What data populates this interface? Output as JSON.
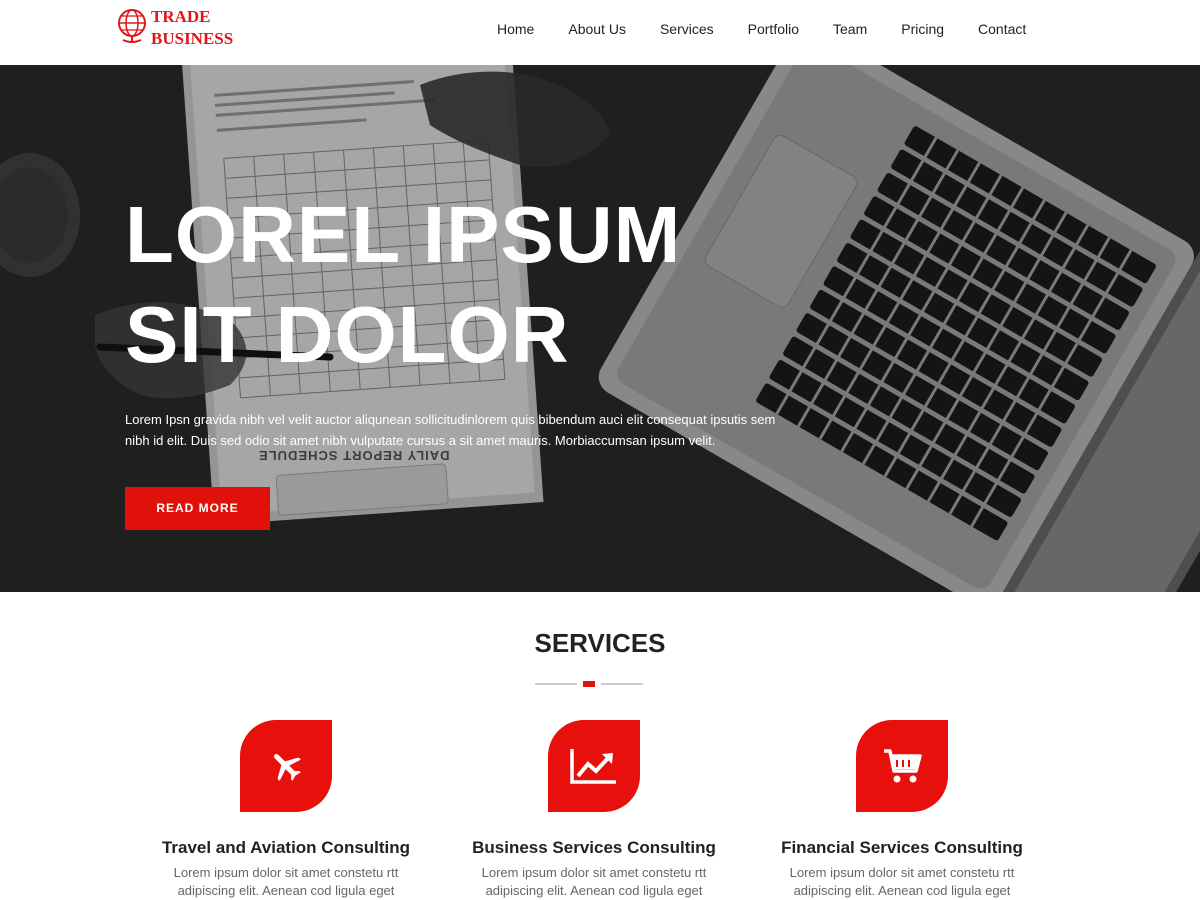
{
  "brand": {
    "line1": "TRADE",
    "line2": "BUSINESS",
    "color": "#e0161b"
  },
  "nav": {
    "items": [
      {
        "label": "Home"
      },
      {
        "label": "About Us"
      },
      {
        "label": "Services"
      },
      {
        "label": "Portfolio"
      },
      {
        "label": "Team"
      },
      {
        "label": "Pricing"
      },
      {
        "label": "Contact"
      }
    ]
  },
  "hero": {
    "title_line1": "LOREL IPSUM",
    "title_line2": "SIT DOLOR",
    "text": "Lorem Ipsn gravida nibh vel velit auctor aliqunean sollicitudinlorem quis bibendum auci elit consequat ipsutis sem nibh id elit. Duis sed odio sit amet nibh vulputate cursus a sit amet mauris. Morbiaccumsan ipsum velit.",
    "button_label": "READ MORE",
    "document_text": "DAILY REPORT SCHEDULE"
  },
  "services": {
    "title": "SERVICES",
    "items": [
      {
        "icon": "airplane-icon",
        "title": "Travel and Aviation Consulting",
        "desc_line1": "Lorem ipsum dolor sit amet constetu rtt",
        "desc_line2": "adipiscing elit. Aenean cod ligula eget"
      },
      {
        "icon": "chart-line-icon",
        "title": "Business Services Consulting",
        "desc_line1": "Lorem ipsum dolor sit amet constetu rtt",
        "desc_line2": "adipiscing elit. Aenean cod ligula eget"
      },
      {
        "icon": "cart-icon",
        "title": "Financial Services Consulting",
        "desc_line1": "Lorem ipsum dolor sit amet constetu rtt",
        "desc_line2": "adipiscing elit. Aenean cod ligula eget"
      }
    ]
  },
  "colors": {
    "accent": "#e0110b",
    "text": "#222222",
    "muted": "#666666"
  }
}
